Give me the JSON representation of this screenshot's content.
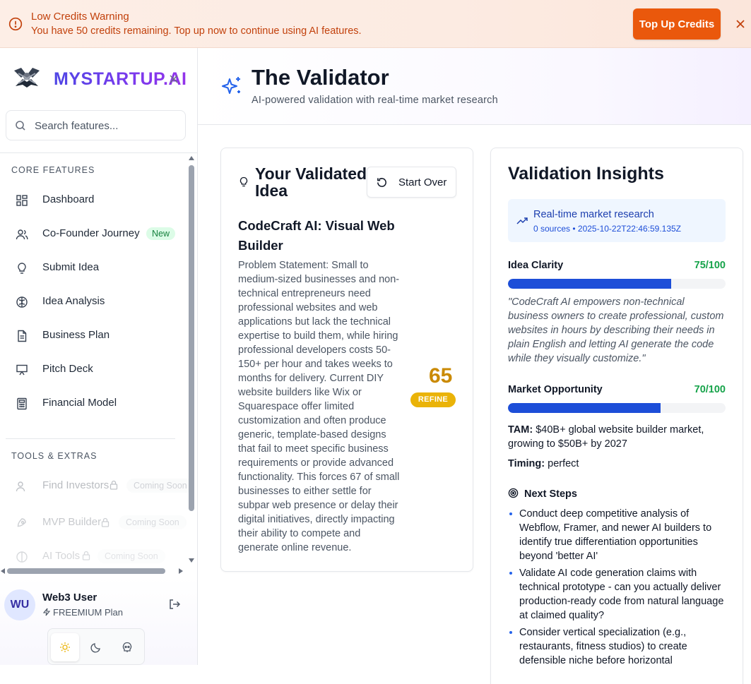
{
  "banner": {
    "title": "Low Credits Warning",
    "message": "You have 50 credits remaining. Top up now to continue using AI features.",
    "cta_label": "Top Up Credits"
  },
  "sidebar": {
    "brand": "MYSTARTUP.AI",
    "search_placeholder": "Search features...",
    "core_label": "CORE FEATURES",
    "core_items": [
      {
        "label": "Dashboard",
        "icon": "dashboard-icon"
      },
      {
        "label": "Co-Founder Journey",
        "icon": "users-icon",
        "badge": "New"
      },
      {
        "label": "Submit Idea",
        "icon": "lightbulb-icon"
      },
      {
        "label": "Idea Analysis",
        "icon": "brain-icon"
      },
      {
        "label": "Business Plan",
        "icon": "document-icon"
      },
      {
        "label": "Pitch Deck",
        "icon": "presentation-icon"
      },
      {
        "label": "Financial Model",
        "icon": "calculator-icon"
      }
    ],
    "tools_label": "TOOLS & EXTRAS",
    "tools_items": [
      {
        "label": "Find Investors",
        "icon": "users-icon",
        "badge": "Coming Soon"
      },
      {
        "label": "MVP Builder",
        "icon": "rocket-icon",
        "badge": "Coming Soon"
      },
      {
        "label": "AI Tools",
        "icon": "brain-icon",
        "badge": "Coming Soon"
      }
    ],
    "user": {
      "initials": "WU",
      "name": "Web3 User",
      "plan": "FREEMIUM Plan"
    }
  },
  "header": {
    "title": "The Validator",
    "subtitle": "AI-powered validation with real-time market research"
  },
  "idea_card": {
    "heading": "Your Validated Idea",
    "start_over_label": "Start Over",
    "idea_title": "CodeCraft AI: Visual Web Builder",
    "description": "Problem Statement: Small to medium-sized businesses and non-technical entrepreneurs need professional websites and web applications but lack the technical expertise to build them, while hiring professional developers costs 50-150+ per hour and takes weeks to months for delivery. Current DIY website builders like Wix or Squarespace offer limited customization and often produce generic, template-based designs that fail to meet specific business requirements or provide advanced functionality. This forces 67 of small businesses to either settle for subpar web presence or delay their digital initiatives, directly impacting their ability to compete and generate online revenue.",
    "score": "65",
    "verdict": "REFINE"
  },
  "insights": {
    "heading": "Validation Insights",
    "research_title": "Real-time market research",
    "research_meta": "0 sources • 2025-10-22T22:46:59.135Z",
    "idea_clarity": {
      "label": "Idea Clarity",
      "score_text": "75/100",
      "value": 0.75
    },
    "quote": "\"CodeCraft AI empowers non-technical business owners to create professional, custom websites in hours by describing their needs in plain English and letting AI generate the code while they visually customize.\"",
    "market": {
      "label": "Market Opportunity",
      "score_text": "70/100",
      "value": 0.7
    },
    "tam_label": "TAM:",
    "tam_value": "$40B+ global website builder market, growing to $50B+ by 2027",
    "timing_label": "Timing:",
    "timing_value": "perfect",
    "next_steps_label": "Next Steps",
    "next_steps": [
      "Conduct deep competitive analysis of Webflow, Framer, and newer AI builders to identify true differentiation opportunities beyond 'better AI'",
      "Validate AI code generation claims with technical prototype - can you actually deliver production-ready code from natural language at claimed quality?",
      "Consider vertical specialization (e.g., restaurants, fitness studios) to create defensible niche before horizontal"
    ]
  },
  "colors": {
    "accent": "#ea580c",
    "brand": "#4f46e5",
    "progress": "#1d4ed8",
    "score_good": "#16a34a",
    "score_warn": "#ca8a04"
  }
}
